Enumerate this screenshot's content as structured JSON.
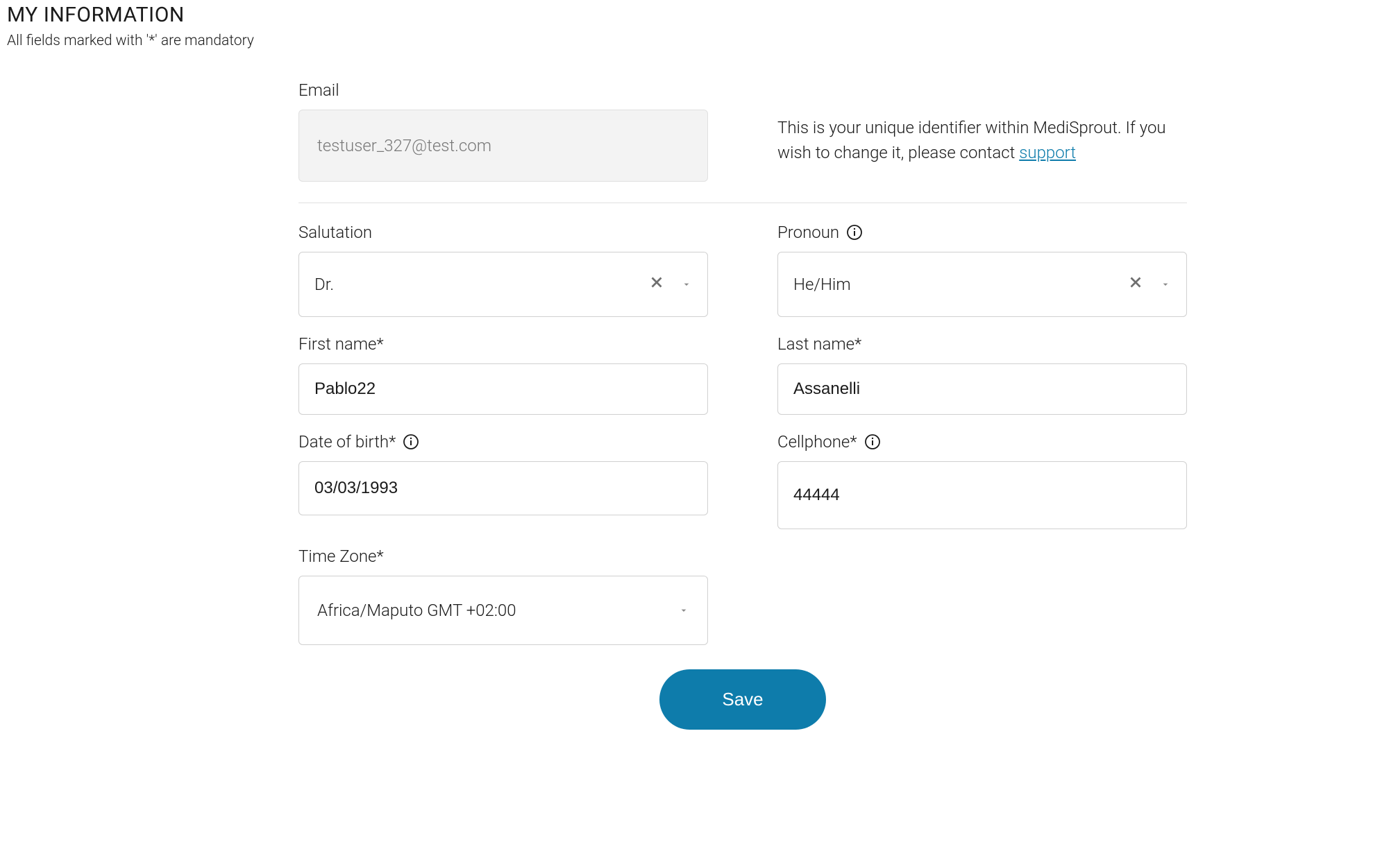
{
  "header": {
    "title": "MY INFORMATION",
    "note": "All fields marked with '*' are mandatory"
  },
  "email": {
    "label": "Email",
    "value": "testuser_327@test.com",
    "help_text": "This is your unique identifier within MediSprout. If you wish to change it, please contact ",
    "help_link_text": "support"
  },
  "salutation": {
    "label": "Salutation",
    "value": "Dr."
  },
  "pronoun": {
    "label": "Pronoun",
    "value": "He/Him"
  },
  "first_name": {
    "label": "First name*",
    "value": "Pablo22"
  },
  "last_name": {
    "label": "Last name*",
    "value": "Assanelli"
  },
  "dob": {
    "label": "Date of birth*",
    "value": "03/03/1993"
  },
  "cellphone": {
    "label": "Cellphone*",
    "value": "44444"
  },
  "timezone": {
    "label": "Time Zone*",
    "value": "Africa/Maputo GMT +02:00"
  },
  "buttons": {
    "save": "Save"
  }
}
